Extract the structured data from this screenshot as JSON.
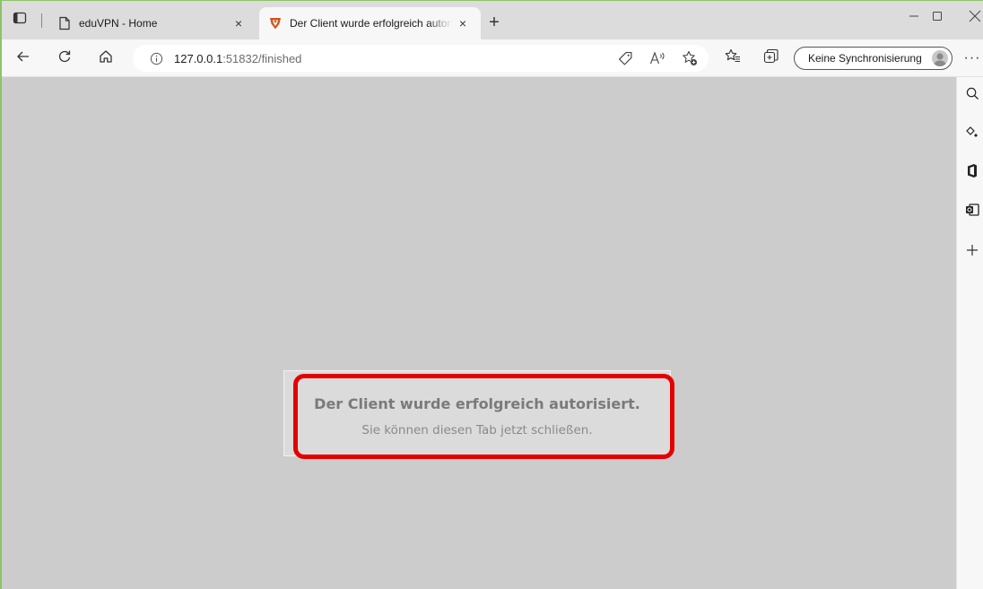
{
  "browser": {
    "tabs": [
      {
        "title": "eduVPN - Home",
        "icon": "page-icon",
        "active": false
      },
      {
        "title": "Der Client wurde erfolgreich autorisiert",
        "icon": "eduvpn-favicon",
        "active": true
      }
    ],
    "close_glyph": "×",
    "new_tab_glyph": "+",
    "window_controls": {
      "minimize": "—",
      "maximize": "☐",
      "close": "✕"
    }
  },
  "addressbar": {
    "url_host": "127.0.0.1",
    "url_rest": ":51832/finished",
    "sync_label": "Keine Synchronisierung",
    "more_glyph": "···"
  },
  "page": {
    "title": "Der Client wurde erfolgreich autorisiert.",
    "subtitle": "Sie können diesen Tab jetzt schließen."
  },
  "colors": {
    "highlight": "#e50000",
    "page_background": "#cccccc",
    "card_background": "#dbdbdb",
    "favicon_accent": "#d1531b"
  },
  "sidebar": {
    "icons": [
      "search-icon",
      "copilot-icon",
      "office-icon",
      "outlook-icon",
      "add-icon"
    ]
  }
}
